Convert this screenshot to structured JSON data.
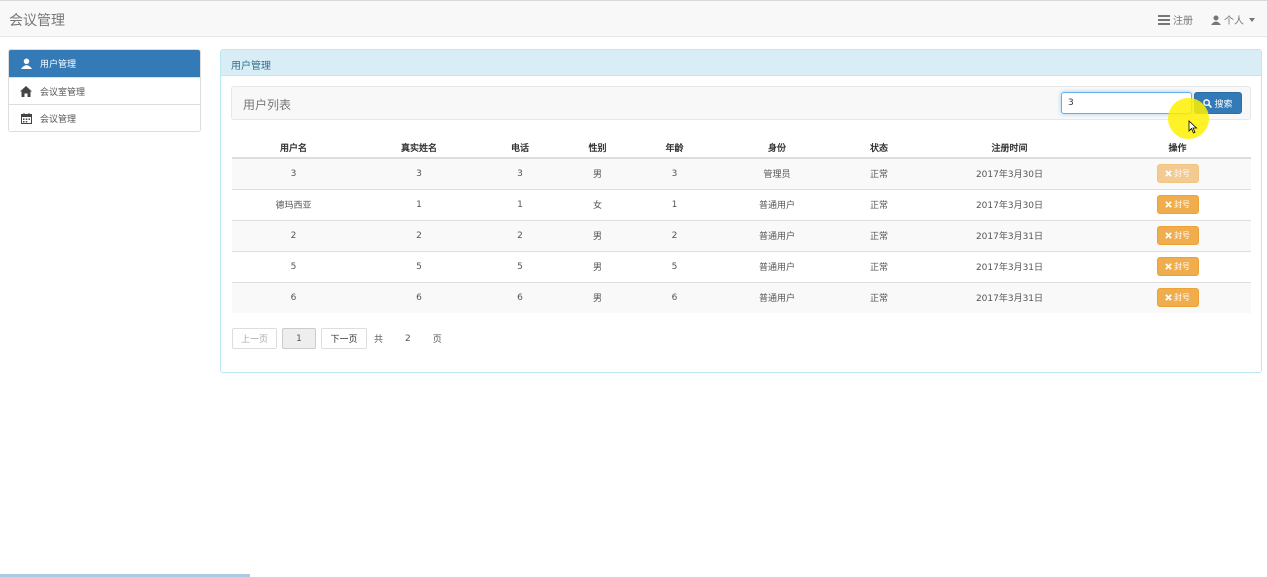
{
  "app": {
    "brand": "会议管理"
  },
  "navbar": {
    "register_label": "注册",
    "personal_label": "个人"
  },
  "sidebar": {
    "items": [
      {
        "label": "用户管理",
        "icon": "user-icon",
        "active": true
      },
      {
        "label": "会议室管理",
        "icon": "home-icon",
        "active": false
      },
      {
        "label": "会议管理",
        "icon": "calendar-icon",
        "active": false
      }
    ]
  },
  "panel": {
    "heading": "用户管理"
  },
  "list": {
    "title": "用户列表",
    "search_value": "3",
    "search_button": "搜索"
  },
  "table": {
    "columns": [
      "用户名",
      "真实姓名",
      "电话",
      "性别",
      "年龄",
      "身份",
      "状态",
      "注册时间",
      "操作"
    ],
    "rows": [
      {
        "username": "3",
        "realname": "3",
        "phone": "3",
        "gender": "男",
        "age": "3",
        "role": "管理员",
        "status": "正常",
        "registered": "2017年3月30日",
        "action": "封号"
      },
      {
        "username": "德玛西亚",
        "realname": "1",
        "phone": "1",
        "gender": "女",
        "age": "1",
        "role": "普通用户",
        "status": "正常",
        "registered": "2017年3月30日",
        "action": "封号"
      },
      {
        "username": "2",
        "realname": "2",
        "phone": "2",
        "gender": "男",
        "age": "2",
        "role": "普通用户",
        "status": "正常",
        "registered": "2017年3月31日",
        "action": "封号"
      },
      {
        "username": "5",
        "realname": "5",
        "phone": "5",
        "gender": "男",
        "age": "5",
        "role": "普通用户",
        "status": "正常",
        "registered": "2017年3月31日",
        "action": "封号"
      },
      {
        "username": "6",
        "realname": "6",
        "phone": "6",
        "gender": "男",
        "age": "6",
        "role": "普通用户",
        "status": "正常",
        "registered": "2017年3月31日",
        "action": "封号"
      }
    ]
  },
  "pagination": {
    "prev_label": "上一页",
    "current_page": "1",
    "next_label": "下一页",
    "total_prefix": "共",
    "total_pages": "2",
    "total_suffix": "页"
  },
  "colors": {
    "primary": "#337ab7",
    "warning": "#f0ad4e",
    "panel_heading_bg": "#d9edf7"
  }
}
